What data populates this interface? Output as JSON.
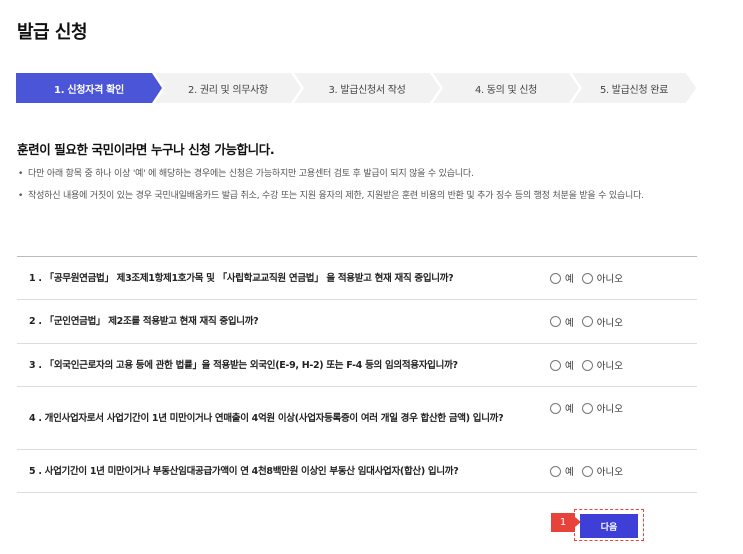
{
  "page": {
    "title": "발급 신청"
  },
  "steps": [
    {
      "label": "1. 신청자격 확인",
      "active": true
    },
    {
      "label": "2. 권리 및 의무사항",
      "active": false
    },
    {
      "label": "3. 발급신청서 작성",
      "active": false
    },
    {
      "label": "4. 동의 및 신청",
      "active": false
    },
    {
      "label": "5. 발급신청 완료",
      "active": false
    }
  ],
  "intro": {
    "title": "훈련이 필요한 국민이라면 누구나 신청 가능합니다.",
    "notes": [
      "다만 아래 항목 중 하나 이상 '예' 에 해당하는 경우에는 신청은 가능하지만 고용센터 검토 후 발급이 되지 않을 수 있습니다.",
      "작성하신 내용에 거짓이 있는 경우 국민내일배움카드 발급 취소, 수강 또는 지원 융자의 제한, 지원받은 훈련 비용의 반환 및 추가 징수 등의 행정 처분을 받을 수 있습니다."
    ]
  },
  "questions": [
    {
      "text": "1 . 「공무원연금법」 제3조제1항제1호가목 및 「사립학교교직원 연금법」 을 적용받고 현재 재직 중입니까?",
      "yes_label": "예",
      "no_label": "아니오"
    },
    {
      "text": "2 . 「군인연금법」 제2조를 적용받고 현재 재직 중입니까?",
      "yes_label": "예",
      "no_label": "아니오"
    },
    {
      "text": "3 . 「외국인근로자의 고용 등에 관한 법률」을 적용받는 외국인(E-9, H-2) 또는 F-4 등의 임의적용자입니까?",
      "yes_label": "예",
      "no_label": "아니오"
    },
    {
      "text": "4 . 개인사업자로서 사업기간이 1년 미만이거나 연매출이 4억원 이상(사업자등록증이 여러 개일 경우 합산한 금액) 입니까?",
      "yes_label": "예",
      "no_label": "아니오"
    },
    {
      "text": "5 . 사업기간이 1년 미만이거나 부동산임대공급가액이 연 4천8백만원 이상인 부동산 임대사업자(합산) 입니까?",
      "yes_label": "예",
      "no_label": "아니오"
    }
  ],
  "footer": {
    "marker": "1",
    "next_label": "다음"
  },
  "colors": {
    "active_step": "#4a55d8",
    "inactive_step": "#f2f2f2",
    "next_button": "#3d3fd6",
    "marker": "#e8433a"
  }
}
